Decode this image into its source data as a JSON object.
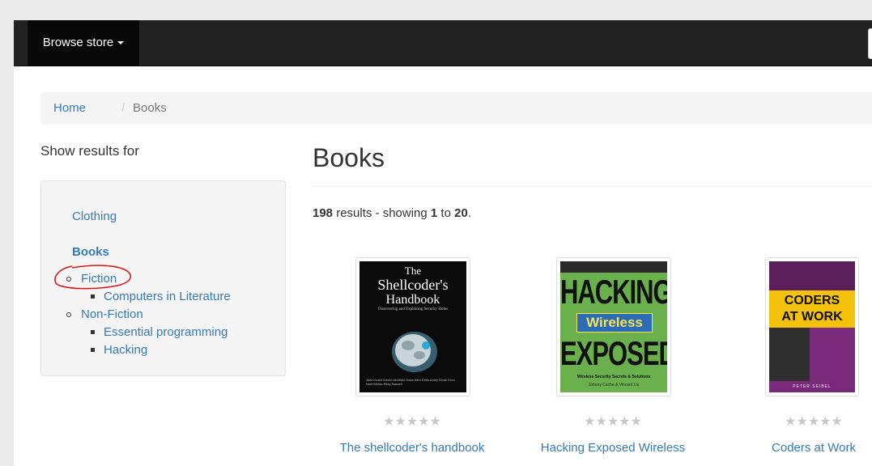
{
  "nav": {
    "browse_label": "Browse store"
  },
  "breadcrumb": {
    "home": "Home",
    "separator": "/",
    "current": "Books"
  },
  "sidebar": {
    "title": "Show results for",
    "categories": [
      {
        "label": "Clothing"
      },
      {
        "label": "Books",
        "bold": true
      },
      {
        "label": "Fiction"
      },
      {
        "label": "Computers in Literature"
      },
      {
        "label": "Non-Fiction"
      },
      {
        "label": "Essential programming"
      },
      {
        "label": "Hacking"
      }
    ]
  },
  "main": {
    "title": "Books",
    "summary": {
      "total": "198",
      "text1": " results - showing ",
      "from": "1",
      "text2": " to ",
      "to": "20",
      "text3": "."
    }
  },
  "products": [
    {
      "title": "The shellcoder's handbook",
      "rating_stars": "★★★★★",
      "rating": 0,
      "cover": {
        "line1": "The",
        "line2": "Shellcoder's",
        "line3": "Handbook",
        "subtitle": "Discovering and Exploiting Security Holes",
        "authors": "Jack Koziol  David Litchfield  Dave Aitel  Chris Anley  Sinan Eren  Neel Mehta  Riley Hassell",
        "bg": "#0b0b0b"
      }
    },
    {
      "title": "Hacking Exposed Wireless",
      "rating_stars": "★★★★★",
      "rating": 0,
      "cover": {
        "word1": "HACKING",
        "word2": "Wireless",
        "word3": "EXPOSED",
        "subtitle": "Wireless Security Secrets & Solutions",
        "authors": "Johnny Cache & Vincent Liu",
        "bg": "#6ab04c"
      }
    },
    {
      "title": "Coders at Work",
      "rating_stars": "★★★★★",
      "rating": 0,
      "cover": {
        "line1": "CODERS",
        "line2": "AT WORK",
        "author": "PETER SEIBEL",
        "bg": "#7a2a7a",
        "band": "#f4c20d"
      }
    }
  ],
  "colors": {
    "link": "#337ab7",
    "navbar": "#222222",
    "annotation": "#d9191c"
  }
}
